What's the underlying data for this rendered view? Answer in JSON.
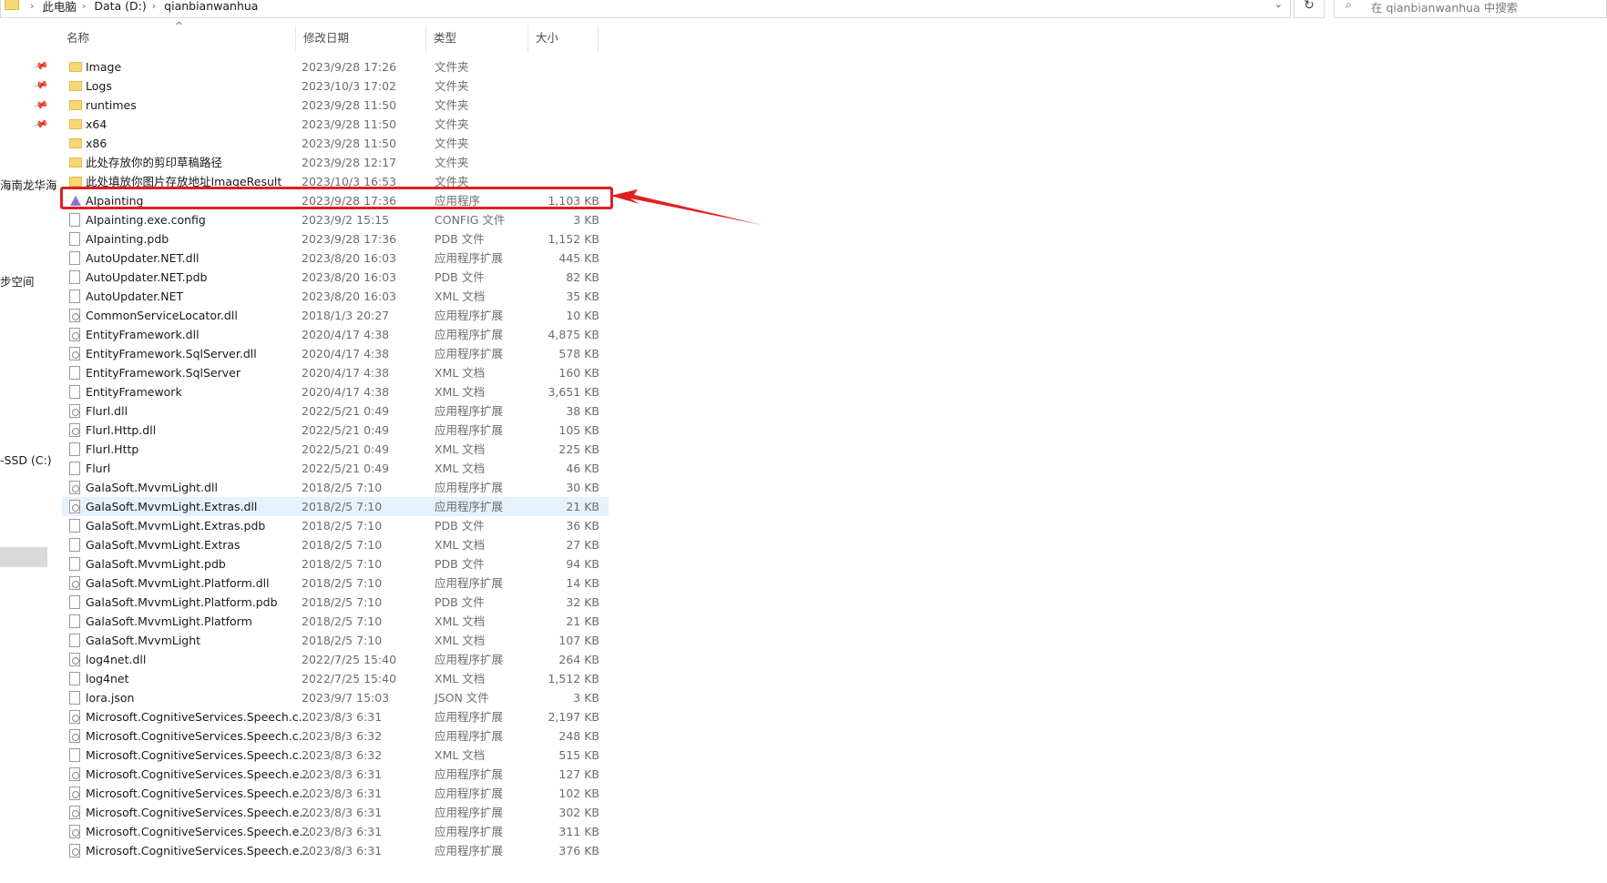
{
  "address_bar": {
    "breadcrumbs": [
      "此电脑",
      "Data (D:)",
      "qianbianwanhua"
    ]
  },
  "search": {
    "placeholder": "在 qianbianwanhua 中搜索"
  },
  "nav_pane": {
    "labels": [
      "海南龙华海",
      "步空间",
      "-SSD (C:)"
    ]
  },
  "columns": {
    "name": "名称",
    "date": "修改日期",
    "type": "类型",
    "size": "大小"
  },
  "files": [
    {
      "name": "Image",
      "date": "2023/9/28 17:26",
      "type": "文件夹",
      "size": "",
      "icon": "folder"
    },
    {
      "name": "Logs",
      "date": "2023/10/3 17:02",
      "type": "文件夹",
      "size": "",
      "icon": "folder"
    },
    {
      "name": "runtimes",
      "date": "2023/9/28 11:50",
      "type": "文件夹",
      "size": "",
      "icon": "folder"
    },
    {
      "name": "x64",
      "date": "2023/9/28 11:50",
      "type": "文件夹",
      "size": "",
      "icon": "folder"
    },
    {
      "name": "x86",
      "date": "2023/9/28 11:50",
      "type": "文件夹",
      "size": "",
      "icon": "folder"
    },
    {
      "name": "此处存放你的剪印草稿路径",
      "date": "2023/9/28 12:17",
      "type": "文件夹",
      "size": "",
      "icon": "folder"
    },
    {
      "name": "此处填放你图片存放地址ImageResult",
      "date": "2023/10/3 16:53",
      "type": "文件夹",
      "size": "",
      "icon": "folder"
    },
    {
      "name": "AIpainting",
      "date": "2023/9/28 17:36",
      "type": "应用程序",
      "size": "1,103 KB",
      "icon": "app"
    },
    {
      "name": "AIpainting.exe.config",
      "date": "2023/9/2 15:15",
      "type": "CONFIG 文件",
      "size": "3 KB",
      "icon": "file"
    },
    {
      "name": "AIpainting.pdb",
      "date": "2023/9/28 17:36",
      "type": "PDB 文件",
      "size": "1,152 KB",
      "icon": "file"
    },
    {
      "name": "AutoUpdater.NET.dll",
      "date": "2023/8/20 16:03",
      "type": "应用程序扩展",
      "size": "445 KB",
      "icon": "file"
    },
    {
      "name": "AutoUpdater.NET.pdb",
      "date": "2023/8/20 16:03",
      "type": "PDB 文件",
      "size": "82 KB",
      "icon": "file"
    },
    {
      "name": "AutoUpdater.NET",
      "date": "2023/8/20 16:03",
      "type": "XML 文档",
      "size": "35 KB",
      "icon": "file"
    },
    {
      "name": "CommonServiceLocator.dll",
      "date": "2018/1/3 20:27",
      "type": "应用程序扩展",
      "size": "10 KB",
      "icon": "dll"
    },
    {
      "name": "EntityFramework.dll",
      "date": "2020/4/17 4:38",
      "type": "应用程序扩展",
      "size": "4,875 KB",
      "icon": "dll"
    },
    {
      "name": "EntityFramework.SqlServer.dll",
      "date": "2020/4/17 4:38",
      "type": "应用程序扩展",
      "size": "578 KB",
      "icon": "dll"
    },
    {
      "name": "EntityFramework.SqlServer",
      "date": "2020/4/17 4:38",
      "type": "XML 文档",
      "size": "160 KB",
      "icon": "file"
    },
    {
      "name": "EntityFramework",
      "date": "2020/4/17 4:38",
      "type": "XML 文档",
      "size": "3,651 KB",
      "icon": "file"
    },
    {
      "name": "Flurl.dll",
      "date": "2022/5/21 0:49",
      "type": "应用程序扩展",
      "size": "38 KB",
      "icon": "dll"
    },
    {
      "name": "Flurl.Http.dll",
      "date": "2022/5/21 0:49",
      "type": "应用程序扩展",
      "size": "105 KB",
      "icon": "dll"
    },
    {
      "name": "Flurl.Http",
      "date": "2022/5/21 0:49",
      "type": "XML 文档",
      "size": "225 KB",
      "icon": "file"
    },
    {
      "name": "Flurl",
      "date": "2022/5/21 0:49",
      "type": "XML 文档",
      "size": "46 KB",
      "icon": "file"
    },
    {
      "name": "GalaSoft.MvvmLight.dll",
      "date": "2018/2/5 7:10",
      "type": "应用程序扩展",
      "size": "30 KB",
      "icon": "dll"
    },
    {
      "name": "GalaSoft.MvvmLight.Extras.dll",
      "date": "2018/2/5 7:10",
      "type": "应用程序扩展",
      "size": "21 KB",
      "icon": "dll",
      "selected": true
    },
    {
      "name": "GalaSoft.MvvmLight.Extras.pdb",
      "date": "2018/2/5 7:10",
      "type": "PDB 文件",
      "size": "36 KB",
      "icon": "file"
    },
    {
      "name": "GalaSoft.MvvmLight.Extras",
      "date": "2018/2/5 7:10",
      "type": "XML 文档",
      "size": "27 KB",
      "icon": "file"
    },
    {
      "name": "GalaSoft.MvvmLight.pdb",
      "date": "2018/2/5 7:10",
      "type": "PDB 文件",
      "size": "94 KB",
      "icon": "file"
    },
    {
      "name": "GalaSoft.MvvmLight.Platform.dll",
      "date": "2018/2/5 7:10",
      "type": "应用程序扩展",
      "size": "14 KB",
      "icon": "dll"
    },
    {
      "name": "GalaSoft.MvvmLight.Platform.pdb",
      "date": "2018/2/5 7:10",
      "type": "PDB 文件",
      "size": "32 KB",
      "icon": "file"
    },
    {
      "name": "GalaSoft.MvvmLight.Platform",
      "date": "2018/2/5 7:10",
      "type": "XML 文档",
      "size": "21 KB",
      "icon": "file"
    },
    {
      "name": "GalaSoft.MvvmLight",
      "date": "2018/2/5 7:10",
      "type": "XML 文档",
      "size": "107 KB",
      "icon": "file"
    },
    {
      "name": "log4net.dll",
      "date": "2022/7/25 15:40",
      "type": "应用程序扩展",
      "size": "264 KB",
      "icon": "dll"
    },
    {
      "name": "log4net",
      "date": "2022/7/25 15:40",
      "type": "XML 文档",
      "size": "1,512 KB",
      "icon": "file"
    },
    {
      "name": "lora.json",
      "date": "2023/9/7 15:03",
      "type": "JSON 文件",
      "size": "3 KB",
      "icon": "file"
    },
    {
      "name": "Microsoft.CognitiveServices.Speech.c...",
      "date": "2023/8/3 6:31",
      "type": "应用程序扩展",
      "size": "2,197 KB",
      "icon": "dll"
    },
    {
      "name": "Microsoft.CognitiveServices.Speech.c...",
      "date": "2023/8/3 6:32",
      "type": "应用程序扩展",
      "size": "248 KB",
      "icon": "dll"
    },
    {
      "name": "Microsoft.CognitiveServices.Speech.c...",
      "date": "2023/8/3 6:32",
      "type": "XML 文档",
      "size": "515 KB",
      "icon": "file"
    },
    {
      "name": "Microsoft.CognitiveServices.Speech.e...",
      "date": "2023/8/3 6:31",
      "type": "应用程序扩展",
      "size": "127 KB",
      "icon": "dll"
    },
    {
      "name": "Microsoft.CognitiveServices.Speech.e...",
      "date": "2023/8/3 6:31",
      "type": "应用程序扩展",
      "size": "102 KB",
      "icon": "dll"
    },
    {
      "name": "Microsoft.CognitiveServices.Speech.e...",
      "date": "2023/8/3 6:31",
      "type": "应用程序扩展",
      "size": "302 KB",
      "icon": "dll"
    },
    {
      "name": "Microsoft.CognitiveServices.Speech.e...",
      "date": "2023/8/3 6:31",
      "type": "应用程序扩展",
      "size": "311 KB",
      "icon": "dll"
    },
    {
      "name": "Microsoft.CognitiveServices.Speech.e...",
      "date": "2023/8/3 6:31",
      "type": "应用程序扩展",
      "size": "376 KB",
      "icon": "dll"
    }
  ],
  "annotation": {
    "highlight_color": "#e02020",
    "target_row": "AIpainting"
  }
}
